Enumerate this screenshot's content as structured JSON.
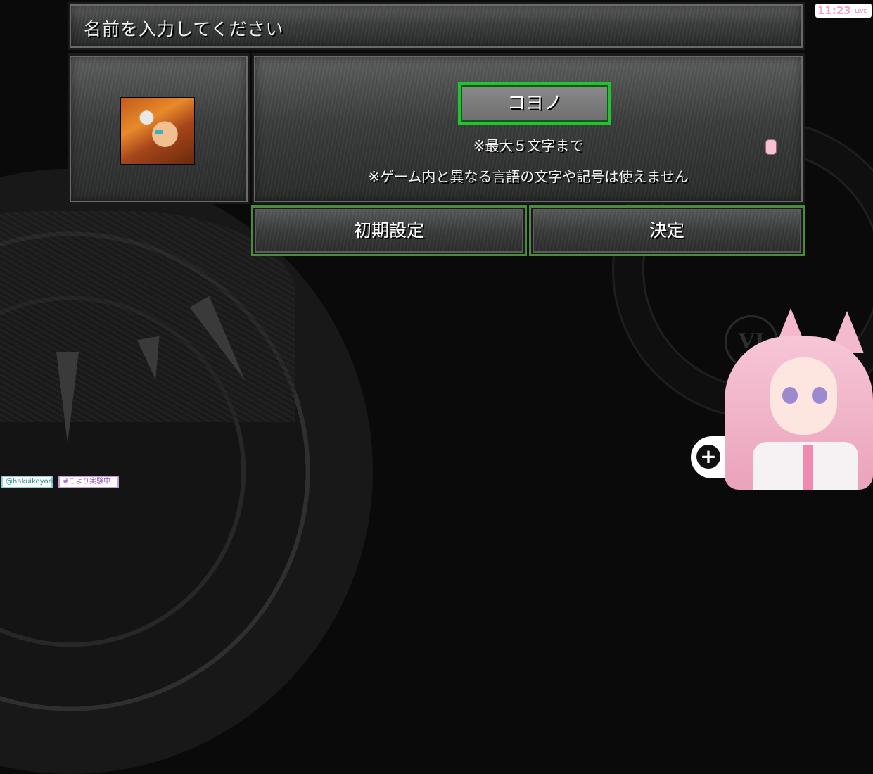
{
  "dialog": {
    "title": "名前を入力してください",
    "name_value": "コヨノ",
    "note_max": "※最大５文字まで",
    "note_symbols": "※ゲーム内と異なる言語の文字や記号は使えません",
    "buttons": {
      "reset": "初期設定",
      "confirm": "決定"
    }
  },
  "overlay": {
    "clock": "11:23",
    "live": "LIVE",
    "handle": "@hakuikoyori",
    "hashtag": "#こより実験中"
  },
  "background": {
    "roman_numeral": "VI"
  },
  "colors": {
    "name_box_border": "#21c331",
    "button_border": "#4a8c3c",
    "clock_text": "#f4a3c5"
  }
}
